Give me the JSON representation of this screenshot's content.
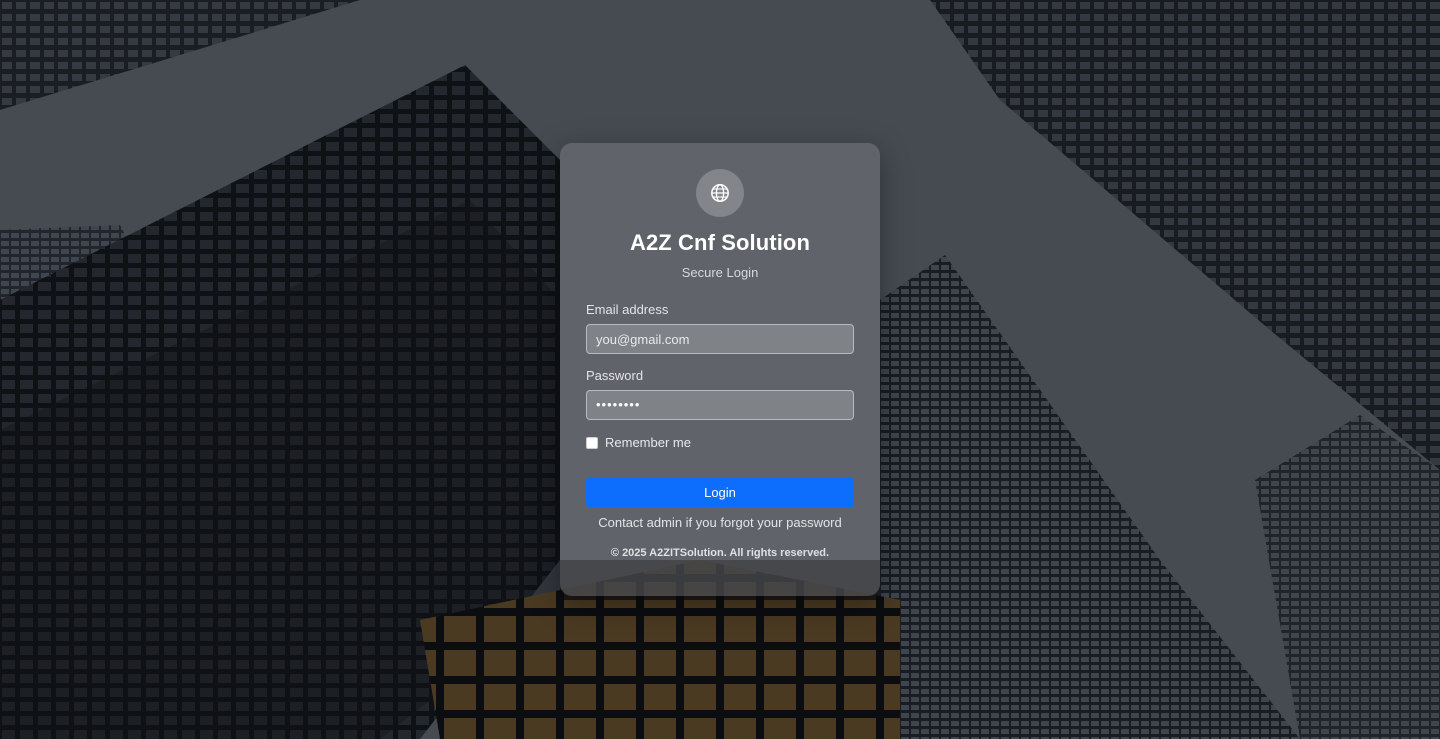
{
  "brand": {
    "title": "A2Z Cnf Solution",
    "subtitle": "Secure Login",
    "logo_icon": "globe-icon"
  },
  "form": {
    "email_label": "Email address",
    "email_value": "you@gmail.com",
    "password_label": "Password",
    "password_value": "••••••••",
    "remember_label": "Remember me",
    "remember_checked": false,
    "login_button": "Login",
    "forgot_text": "Contact admin if you forgot your password"
  },
  "footer": {
    "copyright": "© 2025 A2ZITSolution. All rights reserved."
  },
  "colors": {
    "accent": "#0d6efd",
    "card": "rgba(140,140,145,0.38)"
  }
}
